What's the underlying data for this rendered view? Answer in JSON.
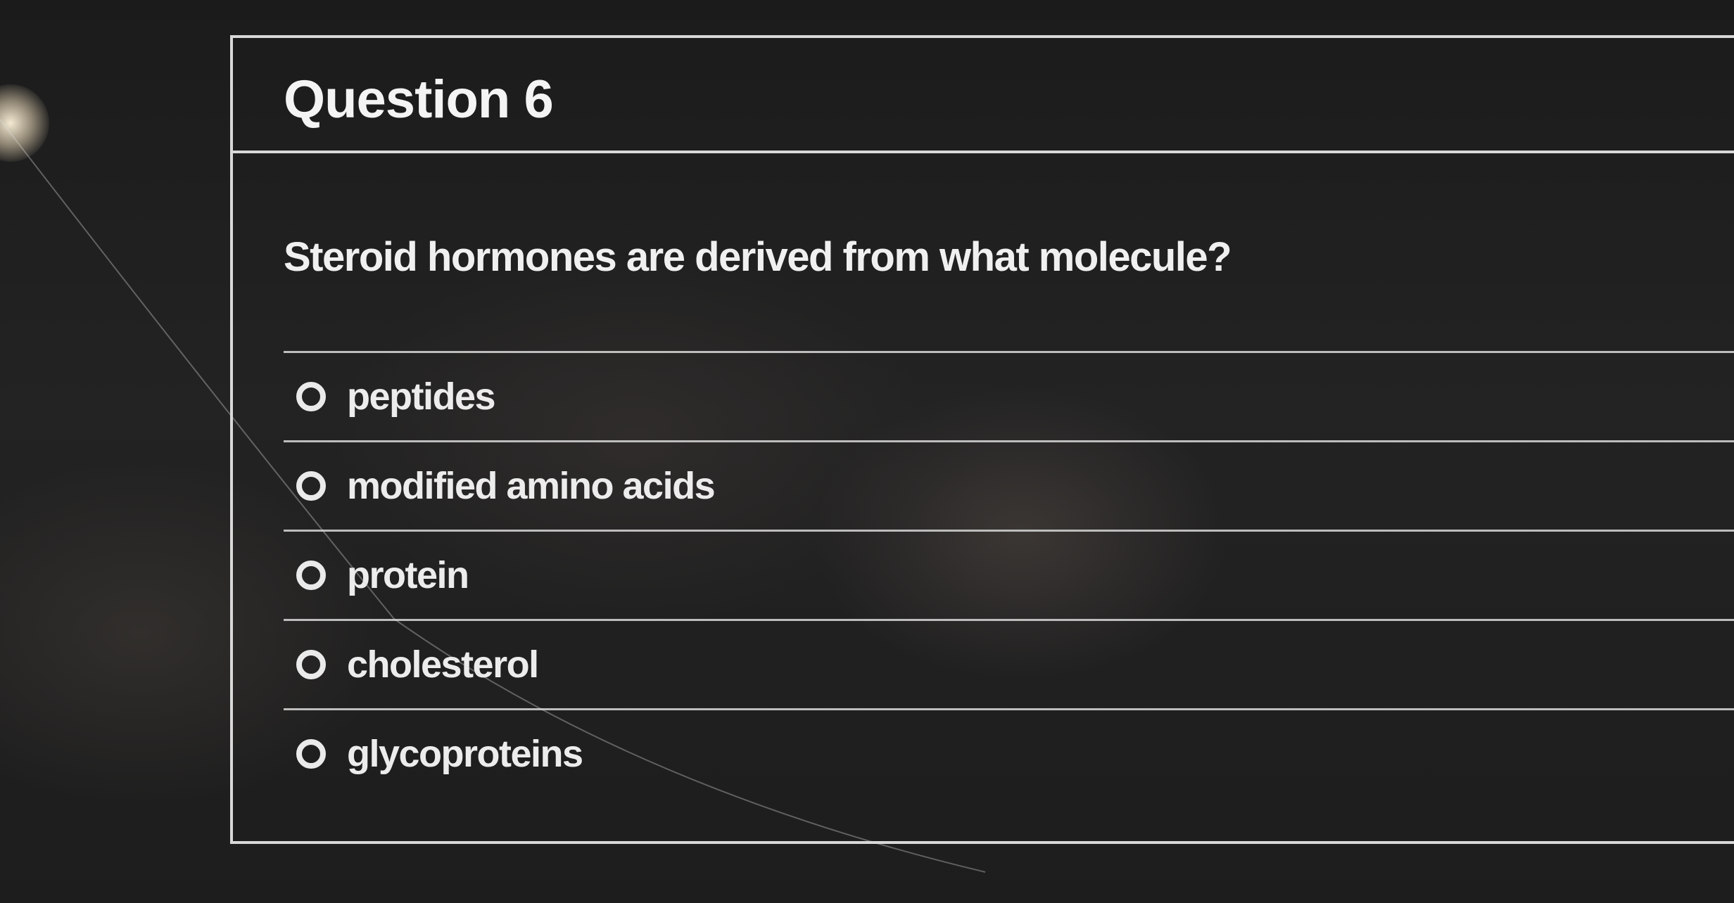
{
  "quiz": {
    "title": "Question 6",
    "question": "Steroid hormones are derived from what molecule?",
    "answers": [
      {
        "label": "peptides",
        "selected": false
      },
      {
        "label": "modified amino acids",
        "selected": false
      },
      {
        "label": "protein",
        "selected": false
      },
      {
        "label": "cholesterol",
        "selected": false
      },
      {
        "label": "glycoproteins",
        "selected": false
      }
    ]
  },
  "colors": {
    "background": "#1b1b1b",
    "border": "#d8d8d8",
    "text": "#f2f2f2"
  }
}
